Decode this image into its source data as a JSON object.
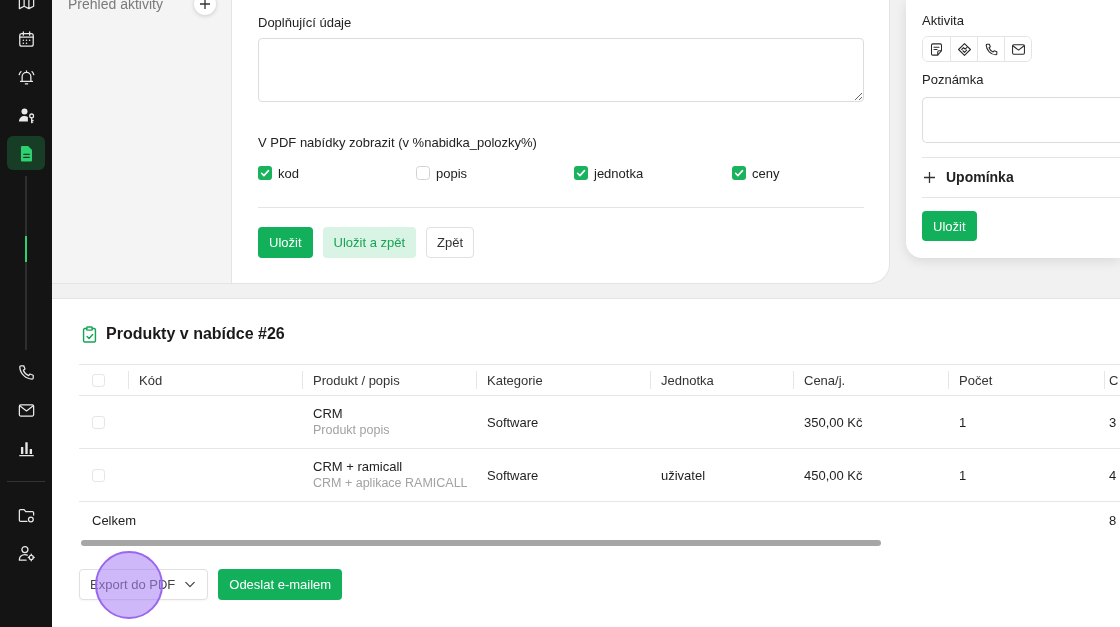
{
  "sidebar": {
    "groups": [
      {
        "items": [
          {
            "selected": false
          },
          {
            "selected": false
          },
          {
            "selected": false
          },
          {
            "selected": false
          },
          {
            "selected": true
          }
        ]
      },
      {
        "items": [
          {
            "selected": false
          },
          {
            "selected": false
          },
          {
            "selected": false
          }
        ]
      },
      {
        "items": [
          {
            "selected": false
          },
          {
            "selected": false
          }
        ]
      }
    ]
  },
  "activity_overview": {
    "title": "Přehled aktivity"
  },
  "offer_form": {
    "additional_info": {
      "label": "Doplňující údaje"
    },
    "pdf_columns": {
      "label": "V PDF nabídky zobrazit (v %nabidka_polozky%)",
      "options": [
        {
          "label": "kod",
          "checked": true
        },
        {
          "label": "popis",
          "checked": false
        },
        {
          "label": "jednotka",
          "checked": true
        },
        {
          "label": "ceny",
          "checked": true
        }
      ]
    },
    "buttons": [
      {
        "label": "Uložit",
        "kind": "primary"
      },
      {
        "label": "Uložit a zpět",
        "kind": "secondary"
      },
      {
        "label": "Zpět",
        "kind": "outline"
      }
    ]
  },
  "activity_form": {
    "activity": {
      "label": "Aktivita"
    },
    "note": {
      "label": "Poznámka"
    },
    "reminder": {
      "label": "Upomínka",
      "expanded": false
    },
    "save_button": {
      "label": "Uložit",
      "kind": "primary"
    }
  },
  "products": {
    "title": "Produkty v nabídce #26",
    "all_selected": false,
    "columns": [
      {
        "label": "Kód"
      },
      {
        "label": "Produkt / popis"
      },
      {
        "label": "Kategorie"
      },
      {
        "label": "Jednotka"
      },
      {
        "label": "Cena/j."
      },
      {
        "label": "Počet"
      },
      {
        "label": "C"
      }
    ],
    "rows": [
      {
        "selected": false,
        "product": "CRM",
        "description": "Produkt popis",
        "category": "Software",
        "price": "350,00 Kč",
        "count": "1",
        "column_8": "3"
      },
      {
        "selected": false,
        "product": "CRM + ramicall",
        "description": "CRM + aplikace RAMICALL",
        "category": "Software",
        "unit": "uživatel",
        "price": "450,00 Kč",
        "count": "1",
        "column_8": "4"
      }
    ],
    "total": {
      "label": "Celkem",
      "column_8": "8"
    }
  },
  "actions": {
    "buttons": [
      {
        "label": "Export do PDF",
        "kind": "dropdown"
      },
      {
        "label": "Odeslat e-mailem",
        "kind": "primary"
      }
    ]
  }
}
